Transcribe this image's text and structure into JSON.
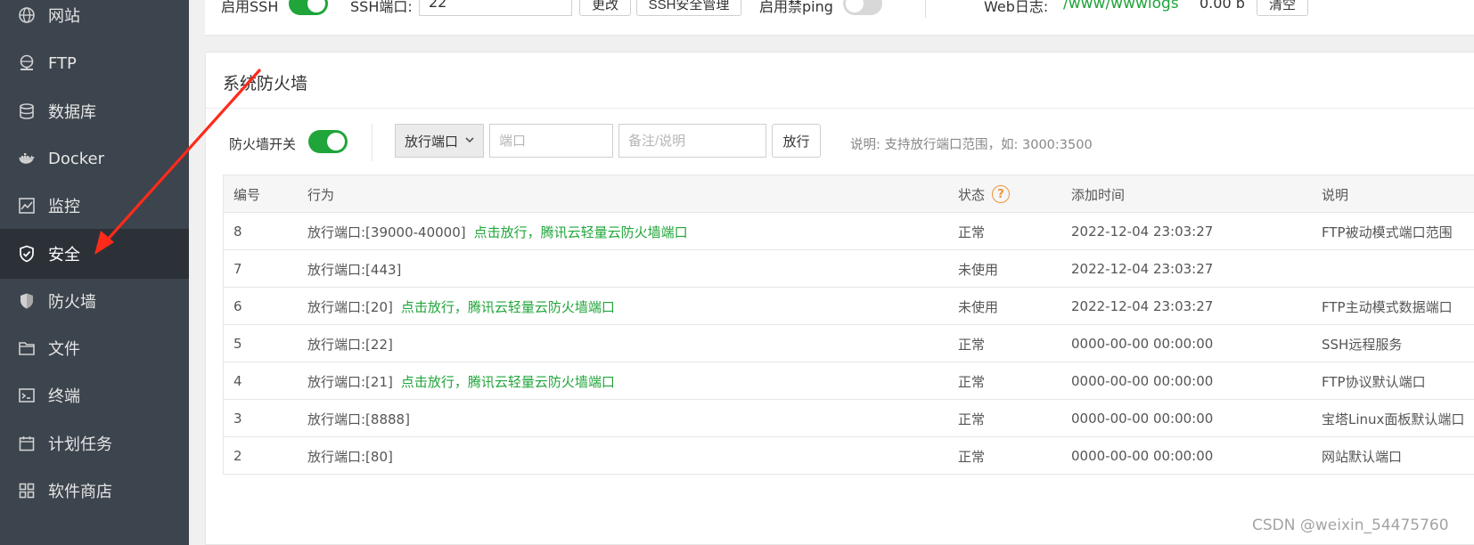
{
  "sidebar": {
    "items": [
      {
        "label": "网站",
        "icon": "globe-icon"
      },
      {
        "label": "FTP",
        "icon": "ftp-globe-icon"
      },
      {
        "label": "数据库",
        "icon": "database-icon"
      },
      {
        "label": "Docker",
        "icon": "docker-icon"
      },
      {
        "label": "监控",
        "icon": "monitor-chart-icon"
      },
      {
        "label": "安全",
        "icon": "shield-check-icon",
        "active": true
      },
      {
        "label": "防火墙",
        "icon": "shield-icon"
      },
      {
        "label": "文件",
        "icon": "folder-icon"
      },
      {
        "label": "终端",
        "icon": "terminal-icon"
      },
      {
        "label": "计划任务",
        "icon": "calendar-icon"
      },
      {
        "label": "软件商店",
        "icon": "grid-icon"
      }
    ]
  },
  "top": {
    "ssh_label": "启用SSH",
    "ssh_port_label": "SSH端口:",
    "ssh_port_value": "22",
    "change_btn": "更改",
    "ssh_manage_btn": "SSH安全管理",
    "ping_label": "启用禁ping",
    "weblog_label": "Web日志:",
    "weblog_path": "/www/wwwlogs",
    "weblog_size": "0.00 b",
    "clear_btn": "清空"
  },
  "firewall": {
    "title": "系统防火墙",
    "switch_label": "防火墙开关",
    "select_value": "放行端口",
    "port_placeholder": "端口",
    "note_placeholder": "备注/说明",
    "allow_btn": "放行",
    "hint": "说明: 支持放行端口范围，如: 3000:3500"
  },
  "table": {
    "headers": {
      "no": "编号",
      "action": "行为",
      "status": "状态",
      "time": "添加时间",
      "desc": "说明"
    },
    "rows": [
      {
        "no": "8",
        "action": "放行端口:[39000-40000]",
        "link": "点击放行，腾讯云轻量云防火墙端口",
        "status": "正常",
        "time": "2022-12-04 23:03:27",
        "desc": "FTP被动模式端口范围"
      },
      {
        "no": "7",
        "action": "放行端口:[443]",
        "link": "",
        "status": "未使用",
        "time": "2022-12-04 23:03:27",
        "desc": ""
      },
      {
        "no": "6",
        "action": "放行端口:[20]",
        "link": "点击放行，腾讯云轻量云防火墙端口",
        "status": "未使用",
        "time": "2022-12-04 23:03:27",
        "desc": "FTP主动模式数据端口"
      },
      {
        "no": "5",
        "action": "放行端口:[22]",
        "link": "",
        "status": "正常",
        "time": "0000-00-00 00:00:00",
        "desc": "SSH远程服务"
      },
      {
        "no": "4",
        "action": "放行端口:[21]",
        "link": "点击放行，腾讯云轻量云防火墙端口",
        "status": "正常",
        "time": "0000-00-00 00:00:00",
        "desc": "FTP协议默认端口"
      },
      {
        "no": "3",
        "action": "放行端口:[8888]",
        "link": "",
        "status": "正常",
        "time": "0000-00-00 00:00:00",
        "desc": "宝塔Linux面板默认端口"
      },
      {
        "no": "2",
        "action": "放行端口:[80]",
        "link": "",
        "status": "正常",
        "time": "0000-00-00 00:00:00",
        "desc": "网站默认端口"
      }
    ]
  },
  "watermark": "CSDN @weixin_54475760",
  "colors": {
    "accent": "#20a53a",
    "sidebar": "#3c444d",
    "sidebar_active": "#2c3138",
    "help": "#f0943a",
    "arrow": "#ff2a1a"
  }
}
